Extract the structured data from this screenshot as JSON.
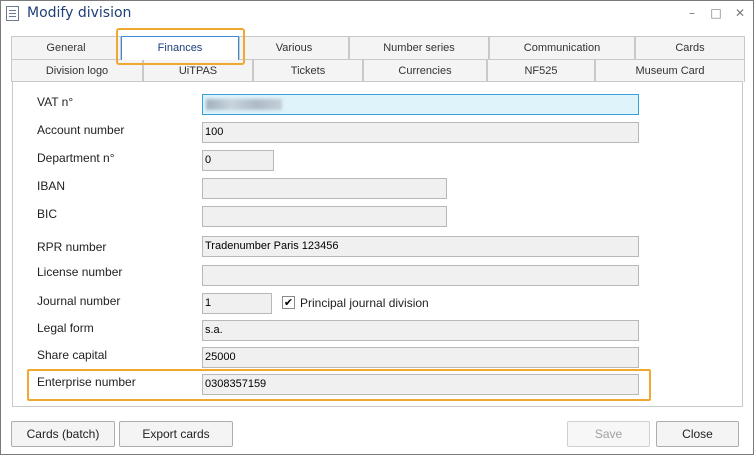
{
  "window": {
    "title": "Modify division",
    "minimize": "–",
    "maximize": "□",
    "close": "✕"
  },
  "tabs": {
    "row1": [
      "General",
      "Finances",
      "Various",
      "Number series",
      "Communication",
      "Cards"
    ],
    "row2": [
      "Division logo",
      "UiTPAS",
      "Tickets",
      "Currencies",
      "NF525",
      "Museum Card"
    ],
    "active": "Finances"
  },
  "form": {
    "vat": {
      "label": "VAT n°",
      "value": ""
    },
    "account_number": {
      "label": "Account number",
      "value": "100"
    },
    "department": {
      "label": "Department n°",
      "value": "0"
    },
    "iban": {
      "label": "IBAN",
      "value": ""
    },
    "bic": {
      "label": "BIC",
      "value": ""
    },
    "rpr_number": {
      "label": "RPR number",
      "value": "Tradenumber Paris 123456"
    },
    "license_number": {
      "label": "License number",
      "value": ""
    },
    "journal_number": {
      "label": "Journal number",
      "value": "1"
    },
    "principal_journal": {
      "label": "Principal journal division",
      "checked": true,
      "mark": "✔"
    },
    "legal_form": {
      "label": "Legal form",
      "value": "s.a."
    },
    "share_capital": {
      "label": "Share capital",
      "value": "25000"
    },
    "enterprise_number": {
      "label": "Enterprise number",
      "value": "0308357159"
    }
  },
  "buttons": {
    "cards_batch": "Cards (batch)",
    "export_cards": "Export cards",
    "save": "Save",
    "close": "Close"
  },
  "colors": {
    "highlight": "#f0a830",
    "title": "#1f3f7a",
    "focus_field": "#dff3fb"
  }
}
